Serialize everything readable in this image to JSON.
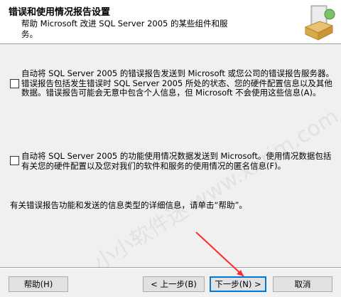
{
  "header": {
    "title": "错误和使用情况报告设置",
    "subtitle": "帮助 Microsoft 改进 SQL Server 2005 的某些组件和服\n务。"
  },
  "options": [
    {
      "checked": false,
      "text": "自动将 SQL Server 2005 的错误报告发送到 Microsoft 或您公司的错误报告服务器。错误报告包括发生错误时 SQL Server 2005 所处的状态、您的硬件配置信息以及其他数据。错误报告可能会无意中包含个人信息，但 Microsoft 不会使用这些信息(A)。"
    },
    {
      "checked": false,
      "text": "自动将 SQL Server 2005 的功能使用情况数据发送到 Microsoft。使用情况数据包括有关您的硬件配置以及您对我们的软件和服务的使用情况的匿名信息(F)。"
    }
  ],
  "info_text": "有关错误报告功能和发送的信息类型的详细信息，请单击“帮助”。",
  "watermark_text": "小小软件迷 www.xxrjm.com",
  "buttons": {
    "help": "帮助(H)",
    "back": "< 上一步(B)",
    "next": "下一步(N) >",
    "cancel": "取消"
  },
  "colors": {
    "annotation_arrow": "#ff2a2a",
    "focus_border": "#0078d7"
  }
}
